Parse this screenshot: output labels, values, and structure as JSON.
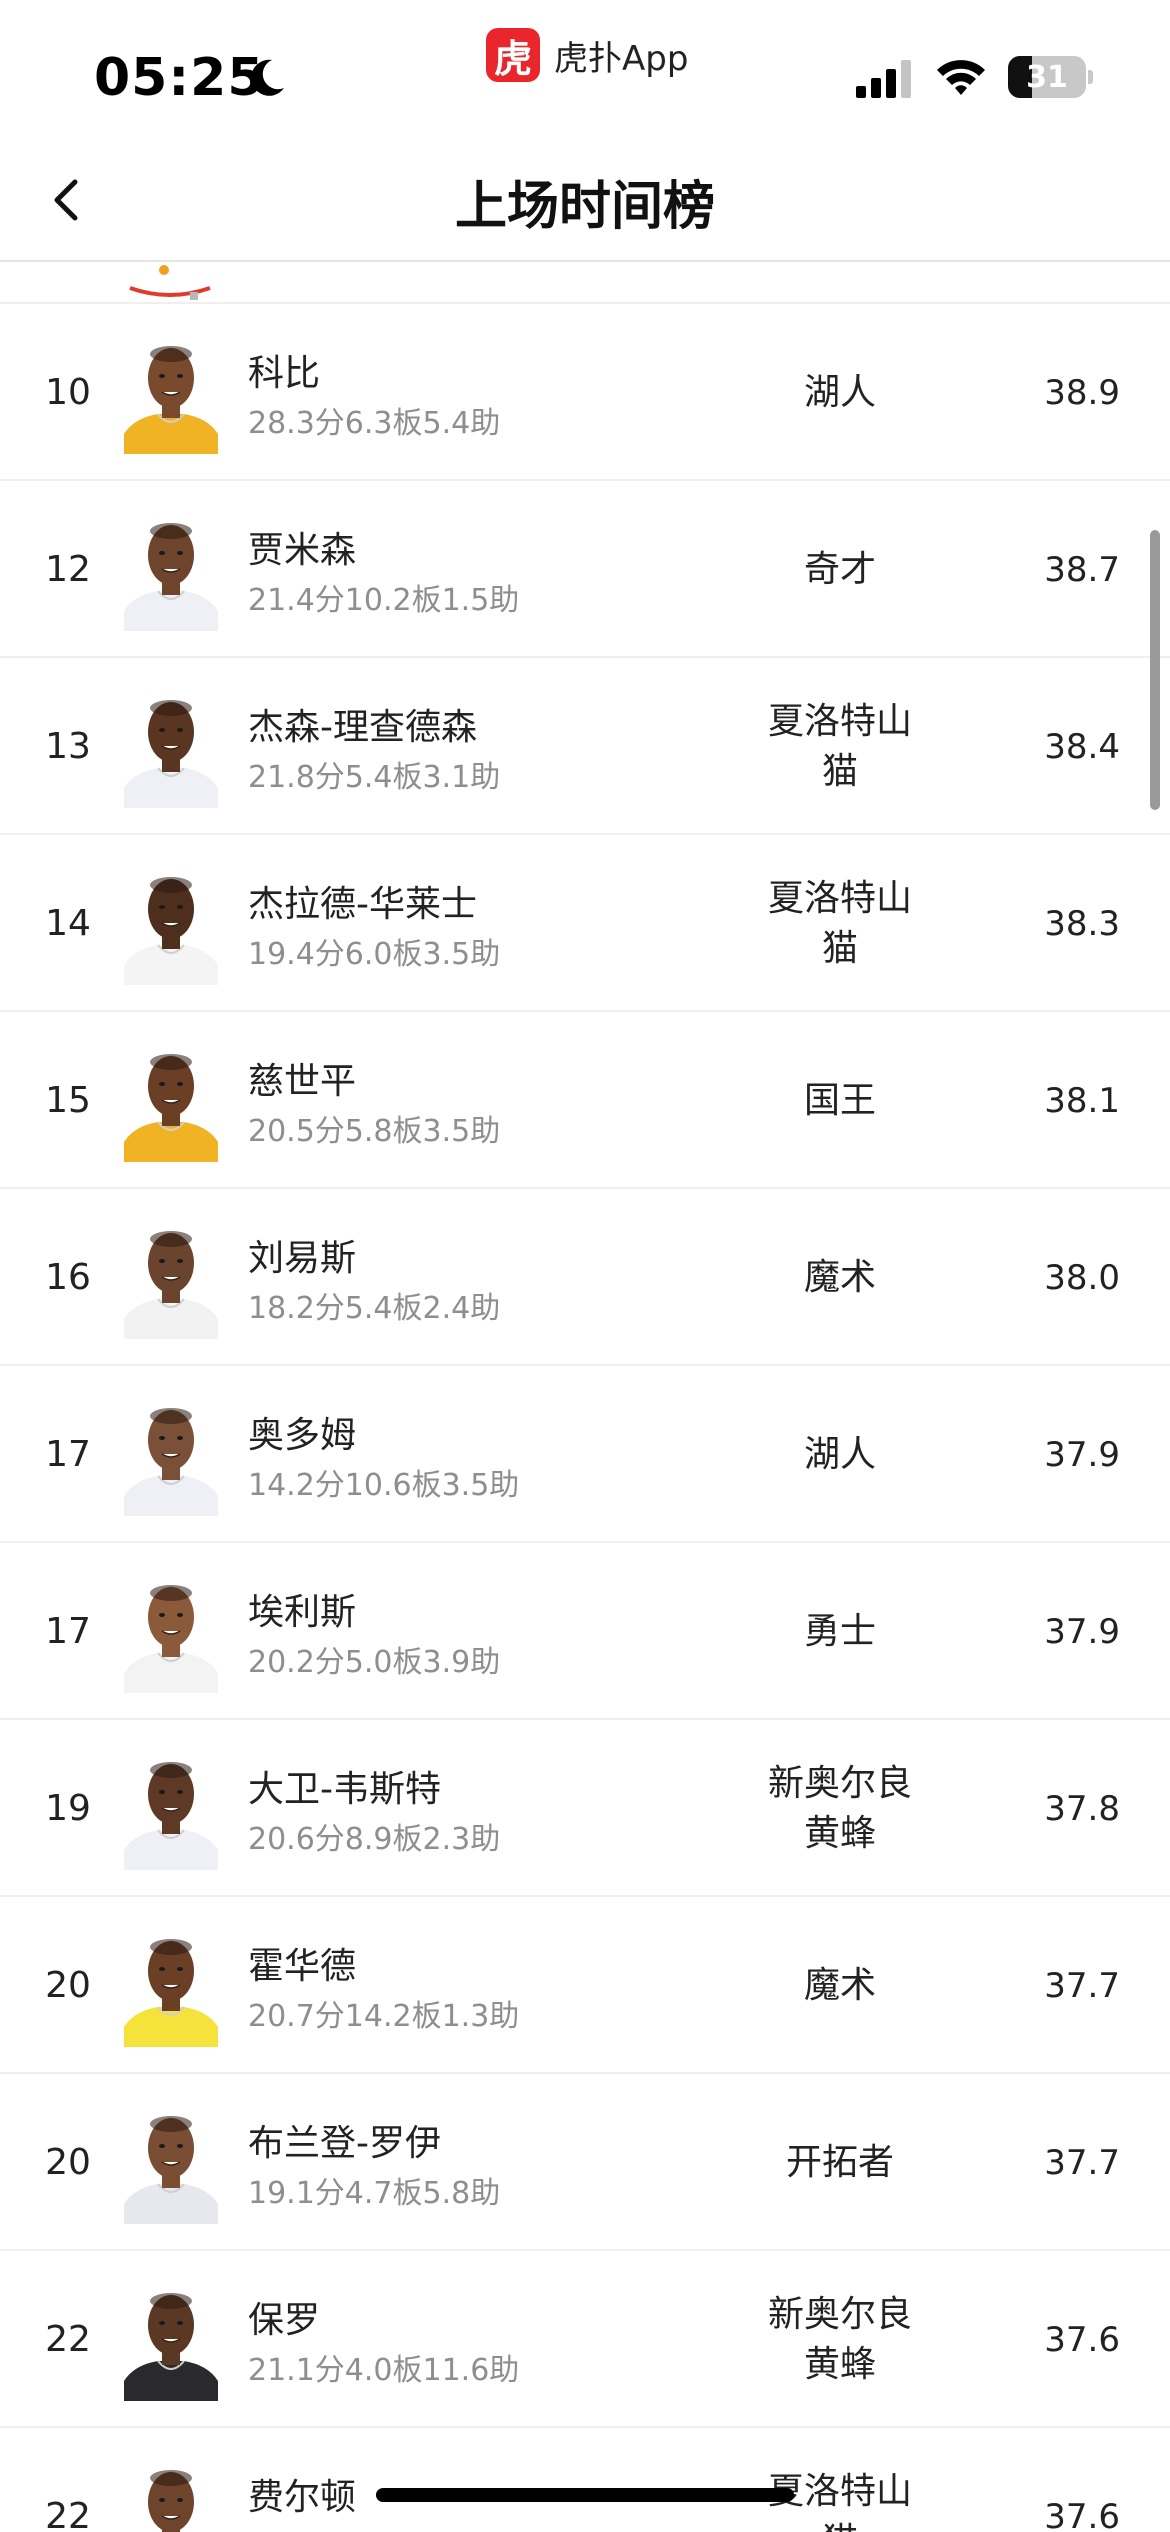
{
  "status_bar": {
    "time": "05:25",
    "app_name": "虎扑App",
    "app_logo_text": "虎",
    "battery": "31",
    "battery_fraction": 0.31,
    "accent": "#e8262c"
  },
  "header": {
    "title": "上场时间榜"
  },
  "players": [
    {
      "rank": "10",
      "name": "科比",
      "stats": "28.3分6.3板5.4助",
      "team": "湖人",
      "minutes": "38.9",
      "skin": "#7a4a2e",
      "jersey": "#f0b323"
    },
    {
      "rank": "12",
      "name": "贾米森",
      "stats": "21.4分10.2板1.5助",
      "team": "奇才",
      "minutes": "38.7",
      "skin": "#6e442c",
      "jersey": "#eef0f6"
    },
    {
      "rank": "13",
      "name": "杰森-理查德森",
      "stats": "21.8分5.4板3.1助",
      "team": "夏洛特山猫",
      "minutes": "38.4",
      "skin": "#5a3622",
      "jersey": "#eef0f6"
    },
    {
      "rank": "14",
      "name": "杰拉德-华莱士",
      "stats": "19.4分6.0板3.5助",
      "team": "夏洛特山猫",
      "minutes": "38.3",
      "skin": "#4e2f1e",
      "jersey": "#f4f4f4"
    },
    {
      "rank": "15",
      "name": "慈世平",
      "stats": "20.5分5.8板3.5助",
      "team": "国王",
      "minutes": "38.1",
      "skin": "#6a3f26",
      "jersey": "#f0b323"
    },
    {
      "rank": "16",
      "name": "刘易斯",
      "stats": "18.2分5.4板2.4助",
      "team": "魔术",
      "minutes": "38.0",
      "skin": "#6b4430",
      "jersey": "#f2f2f2"
    },
    {
      "rank": "17",
      "name": "奥多姆",
      "stats": "14.2分10.6板3.5助",
      "team": "湖人",
      "minutes": "37.9",
      "skin": "#7b5038",
      "jersey": "#eef0f6"
    },
    {
      "rank": "17",
      "name": "埃利斯",
      "stats": "20.2分5.0板3.9助",
      "team": "勇士",
      "minutes": "37.9",
      "skin": "#8a5a3a",
      "jersey": "#f3f3f3"
    },
    {
      "rank": "19",
      "name": "大卫-韦斯特",
      "stats": "20.6分8.9板2.3助",
      "team": "新奥尔良黄蜂",
      "minutes": "37.8",
      "skin": "#5e3a26",
      "jersey": "#eef0f6"
    },
    {
      "rank": "20",
      "name": "霍华德",
      "stats": "20.7分14.2板1.3助",
      "team": "魔术",
      "minutes": "37.7",
      "skin": "#6a3f26",
      "jersey": "#f5e23a"
    },
    {
      "rank": "20",
      "name": "布兰登-罗伊",
      "stats": "19.1分4.7板5.8助",
      "team": "开拓者",
      "minutes": "37.7",
      "skin": "#7a4e34",
      "jersey": "#e6e8ee"
    },
    {
      "rank": "22",
      "name": "保罗",
      "stats": "21.1分4.0板11.6助",
      "team": "新奥尔良黄蜂",
      "minutes": "37.6",
      "skin": "#5a3824",
      "jersey": "#2a2a2e"
    },
    {
      "rank": "22",
      "name": "费尔顿",
      "stats": "",
      "team": "夏洛特山猫",
      "minutes": "37.6",
      "skin": "#6e442c",
      "jersey": "#eef0f6"
    }
  ]
}
